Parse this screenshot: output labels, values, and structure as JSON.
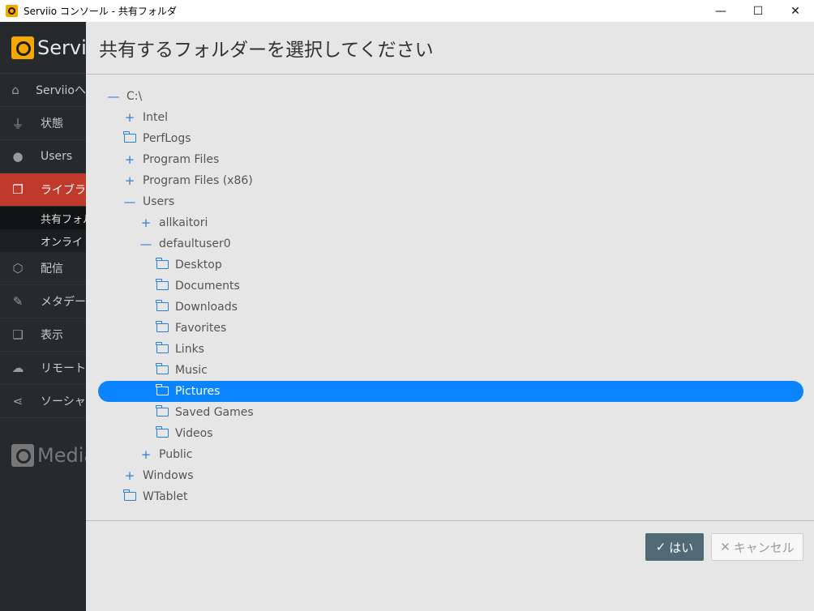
{
  "window": {
    "title": "Serviio コンソール - 共有フォルダ",
    "minimize_glyph": "—",
    "maximize_glyph": "☐",
    "close_glyph": "✕"
  },
  "sidebar": {
    "brand": "Serviio",
    "items": [
      {
        "label": "Serviioへ",
        "icon": "home-icon",
        "glyph": "⌂"
      },
      {
        "label": "状態",
        "icon": "plug-icon",
        "glyph": "⏚"
      },
      {
        "label": "Users",
        "icon": "user-icon",
        "glyph": "●"
      },
      {
        "label": "ライブラ",
        "icon": "library-icon",
        "glyph": "❐"
      }
    ],
    "sub_items": [
      {
        "label": "共有フォル"
      },
      {
        "label": "オンライ"
      }
    ],
    "items_after": [
      {
        "label": "配信",
        "icon": "cube-icon",
        "glyph": "⬡"
      },
      {
        "label": "メタデー",
        "icon": "edit-icon",
        "glyph": "✎"
      },
      {
        "label": "表示",
        "icon": "display-icon",
        "glyph": "❏"
      },
      {
        "label": "リモート",
        "icon": "cloud-icon",
        "glyph": "☁"
      },
      {
        "label": "ソーシャ",
        "icon": "share-icon",
        "glyph": "⋖"
      }
    ],
    "media_brand": "Media"
  },
  "dialog": {
    "title": "共有するフォルダーを選択してください",
    "tree": [
      {
        "label": "C:\\",
        "glyph": "—",
        "state": "expanded",
        "level": 0
      },
      {
        "label": "Intel",
        "glyph": "+",
        "state": "collapsed",
        "level": 1
      },
      {
        "label": "PerfLogs",
        "glyph": "folder",
        "state": "leaf",
        "level": 1
      },
      {
        "label": "Program Files",
        "glyph": "+",
        "state": "collapsed",
        "level": 1
      },
      {
        "label": "Program Files (x86)",
        "glyph": "+",
        "state": "collapsed",
        "level": 1
      },
      {
        "label": "Users",
        "glyph": "—",
        "state": "expanded",
        "level": 1
      },
      {
        "label": "allkaitori",
        "glyph": "+",
        "state": "collapsed",
        "level": 2
      },
      {
        "label": "defaultuser0",
        "glyph": "—",
        "state": "expanded",
        "level": 2
      },
      {
        "label": "Desktop",
        "glyph": "folder",
        "state": "leaf",
        "level": 3
      },
      {
        "label": "Documents",
        "glyph": "folder",
        "state": "leaf",
        "level": 3
      },
      {
        "label": "Downloads",
        "glyph": "folder",
        "state": "leaf",
        "level": 3
      },
      {
        "label": "Favorites",
        "glyph": "folder",
        "state": "leaf",
        "level": 3
      },
      {
        "label": "Links",
        "glyph": "folder",
        "state": "leaf",
        "level": 3
      },
      {
        "label": "Music",
        "glyph": "folder",
        "state": "leaf",
        "level": 3
      },
      {
        "label": "Pictures",
        "glyph": "folder",
        "state": "leaf",
        "level": 3,
        "selected": true
      },
      {
        "label": "Saved Games",
        "glyph": "folder",
        "state": "leaf",
        "level": 3
      },
      {
        "label": "Videos",
        "glyph": "folder",
        "state": "leaf",
        "level": 3
      },
      {
        "label": "Public",
        "glyph": "+",
        "state": "collapsed",
        "level": 2
      },
      {
        "label": "Windows",
        "glyph": "+",
        "state": "collapsed",
        "level": 1
      },
      {
        "label": "WTablet",
        "glyph": "folder",
        "state": "leaf",
        "level": 1
      }
    ],
    "yes_label": "はい",
    "yes_glyph": "✓",
    "cancel_label": "キャンセル",
    "cancel_glyph": "✕"
  },
  "colors": {
    "selection": "#0a84ff",
    "active_nav": "#c0392b",
    "primary_button": "#4f6a75"
  }
}
